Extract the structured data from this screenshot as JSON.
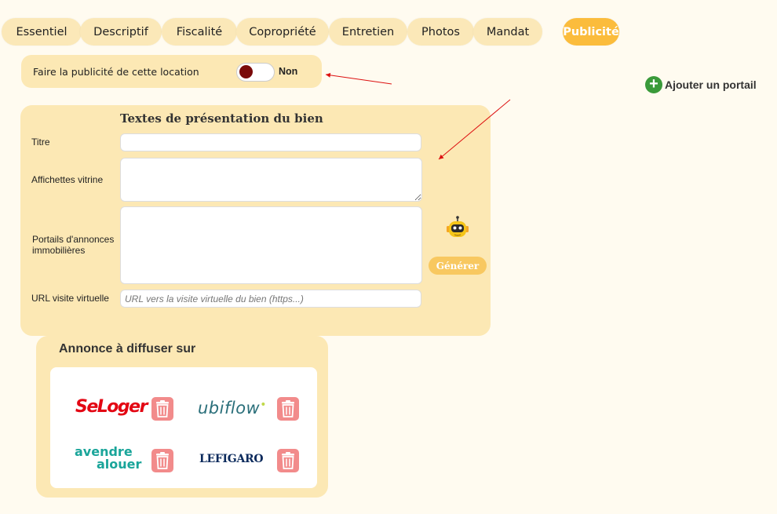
{
  "tabs": [
    {
      "label": "Essentiel"
    },
    {
      "label": "Descriptif"
    },
    {
      "label": "Fiscalité"
    },
    {
      "label": "Copropriété"
    },
    {
      "label": "Entretien"
    },
    {
      "label": "Photos"
    },
    {
      "label": "Mandat"
    },
    {
      "label": "Publicité",
      "active": true
    }
  ],
  "advertise": {
    "label": "Faire la publicité de cette location",
    "state": "Non",
    "knob_color": "#7a0a0a"
  },
  "add_portal": {
    "label": "Ajouter un portail",
    "icon": "plus-circle-icon"
  },
  "presentation": {
    "title": "Textes de présentation du bien",
    "fields": {
      "titre": {
        "label": "Titre",
        "value": ""
      },
      "affichettes": {
        "label": "Affichettes vitrine",
        "value": ""
      },
      "portails": {
        "label_line1": "Portails d'annonces",
        "label_line2": "immobilières",
        "value": ""
      },
      "url": {
        "label": "URL visite virtuelle",
        "value": "",
        "placeholder": "URL vers la visite virtuelle du bien (https...)"
      }
    },
    "generate_label": "Générer",
    "robot_icon": "robot-icon"
  },
  "diffusion": {
    "title": "Annonce à diffuser sur",
    "portals": [
      {
        "name": "SeLoger",
        "brand_color": "#e30613"
      },
      {
        "name": "ubiflow",
        "brand_color": "#2a6f7a"
      },
      {
        "name": "avendrealouer",
        "line1": "avendre",
        "line2": "alouer",
        "brand_color": "#1aa59a"
      },
      {
        "name": "LE FIGARO",
        "part1": "LE",
        "part2": "FIGARO",
        "brand_color": "#0b2a5c"
      }
    ]
  },
  "colors": {
    "accent": "#fbbc3c",
    "tab_bg": "#fbe8b8",
    "card_bg": "#fce8b4",
    "trash": "#f28b8b"
  }
}
